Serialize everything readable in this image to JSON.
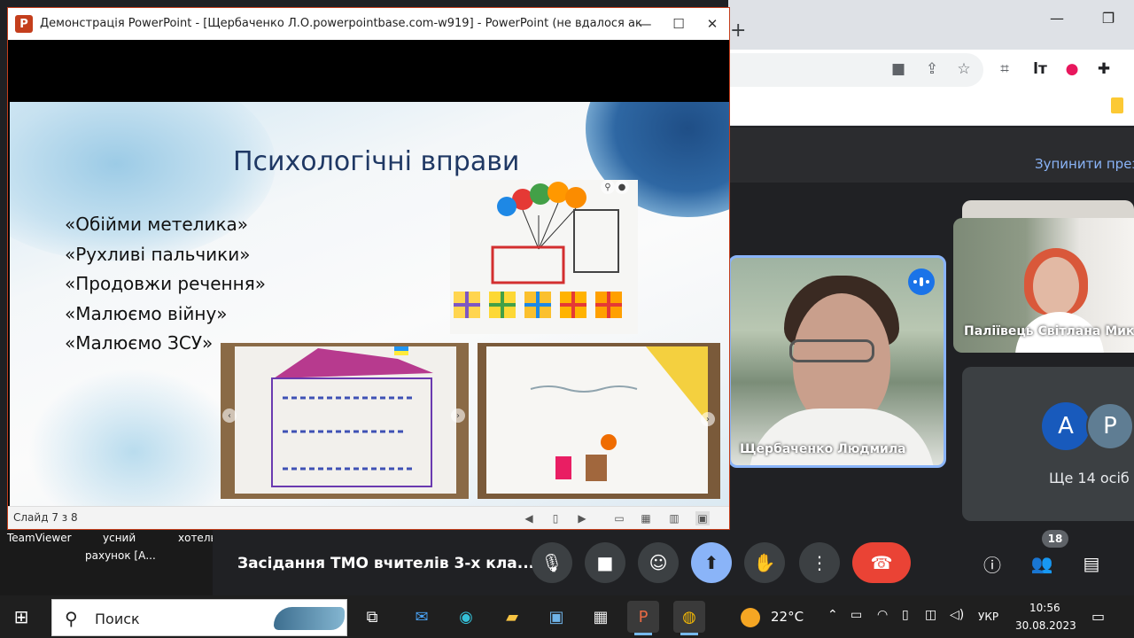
{
  "ppt": {
    "window_title": "Демонстрація PowerPoint - [Щербаченко Л.О.powerpointbase.com-w919] - PowerPoint (не вдалося акт...",
    "logo_letter": "P",
    "status": "Слайд 7 з 8",
    "slide": {
      "title": "Психологічні вправи",
      "items": [
        "«Обійми метелика»",
        "«Рухливі пальчики»",
        "«Продовжи речення»",
        "«Малюємо війну»",
        "«Малюємо ЗСУ»"
      ]
    }
  },
  "meet": {
    "stop_present": "Зупинити през",
    "main_speaker": "Щербаченко Людмила",
    "second_speaker": "Паліївець Світлана Мик",
    "avatar_a": "A",
    "avatar_p": "P",
    "more_people": "Ще 14 осіб",
    "meeting_title": "Засідання ТМО вчителів 3-х кла...",
    "people_count": "18"
  },
  "desktop": {
    "teamviewer": "TeamViewer",
    "label_2": "усний",
    "label_3": "хотель",
    "label_4": "рахунок [А..."
  },
  "taskbar": {
    "search_placeholder": "Поиск",
    "temperature": "22°C",
    "language": "УКР",
    "time": "10:56",
    "date": "30.08.2023"
  },
  "colors": {
    "ppt_accent": "#c43e1c",
    "meet_blue": "#8ab4f8",
    "hangup_red": "#ea4335"
  }
}
